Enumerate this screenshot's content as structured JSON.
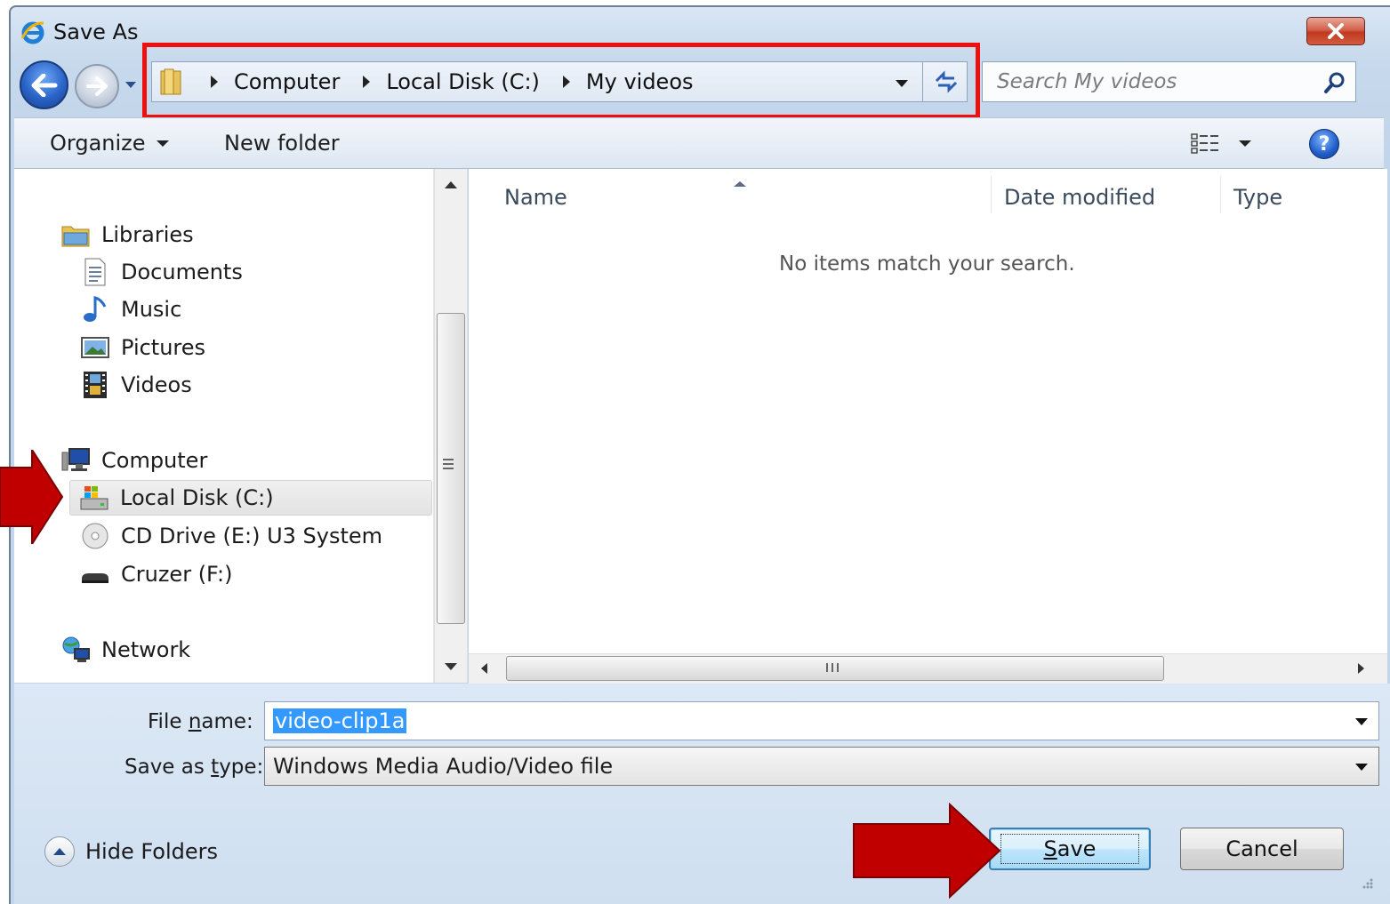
{
  "window": {
    "title": "Save As"
  },
  "address_bar": {
    "crumbs": [
      "Computer",
      "Local Disk (C:)",
      "My videos"
    ]
  },
  "search": {
    "placeholder": "Search My videos"
  },
  "toolbar": {
    "organize_label": "Organize",
    "new_folder_label": "New folder"
  },
  "nav_tree": {
    "libraries": "Libraries",
    "documents": "Documents",
    "music": "Music",
    "pictures": "Pictures",
    "videos": "Videos",
    "computer": "Computer",
    "local_disk": "Local Disk (C:)",
    "cd_drive": "CD Drive (E:) U3 System",
    "cruzer": "Cruzer (F:)",
    "network": "Network",
    "selected": "Local Disk (C:)"
  },
  "file_list": {
    "columns": [
      "Name",
      "Date modified",
      "Type"
    ],
    "sorted_by": "Name",
    "empty_message": "No items match your search."
  },
  "form": {
    "file_name_label_pre": "File ",
    "file_name_label_u": "n",
    "file_name_label_post": "ame:",
    "file_name_value": "video-clip1a",
    "save_type_label_pre": "Save as ",
    "save_type_label_u": "t",
    "save_type_label_post": "ype:",
    "save_type_value": "Windows Media Audio/Video file"
  },
  "footer": {
    "hide_folders_label": "Hide Folders",
    "save_label_u": "S",
    "save_label_rest": "ave",
    "cancel_label": "Cancel"
  },
  "colors": {
    "highlight_box": "#ee0f0f",
    "callout_arrow": "#c00000",
    "selection": "#3399ff"
  },
  "icons": {
    "title": "internet-explorer-icon",
    "close": "close-icon",
    "back": "back-arrow-icon",
    "forward": "forward-arrow-icon",
    "refresh": "refresh-icon",
    "search": "search-icon",
    "views": "views-icon",
    "help": "help-icon"
  }
}
